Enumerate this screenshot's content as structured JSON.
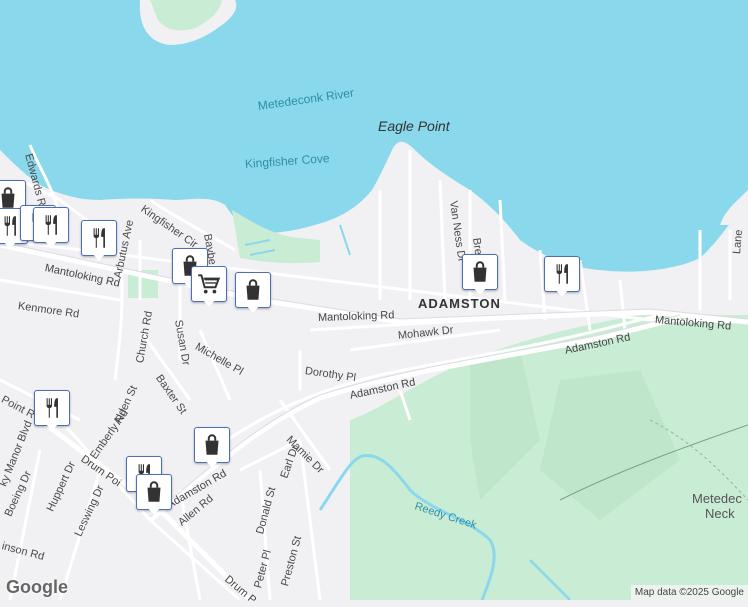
{
  "colors": {
    "water": "#8ad8ec",
    "land": "#f1f1f4",
    "park": "#c9ecd4",
    "road": "#ffffff",
    "pin_border": "#4d6fb5"
  },
  "labels": {
    "metedeconk_river": "Metedeconk River",
    "eagle_point": "Eagle Point",
    "kingfisher_cove": "Kingfisher Cove",
    "adamston": "ADAMSTON",
    "metedeconk_neck": "Metedec",
    "metedeconk_neck2": "Neck",
    "reedy_creek": "Reedy Creek"
  },
  "roads": {
    "mantoloking_rd_w": "Mantoloking Rd",
    "mantoloking_rd_c": "Mantoloking Rd",
    "mantoloking_rd_e": "Mantoloking Rd",
    "adamston_rd_c": "Adamston Rd",
    "adamston_rd_e": "Adamston Rd",
    "adamston_rd_sw": "Adamston Rd",
    "kenmore_rd": "Kenmore Rd",
    "mohawk_dr": "Mohawk Dr",
    "dorothy_pl": "Dorothy Pl",
    "edwards_rd": "Edwards Rd",
    "kingfisher_cir": "Kingfisher Cir",
    "arbutus_ave": "Arbutus Ave",
    "baybe": "Baybe",
    "church_rd": "Church Rd",
    "susan_dr": "Susan Dr",
    "michelle_pl": "Michelle Pl",
    "baxter_st": "Baxter St",
    "alden_st": "Alden St",
    "emberly_rd": "Emberly Rd",
    "point_rd": "Point R",
    "sky_manor_blvd": "ky Manor Blvd",
    "drum_point_rd_w": "Drum Poi",
    "drum_point_rd_s": "Drum P",
    "huppert_dr": "Huppert Dr",
    "boeing_dr": "Boeing Dr",
    "leswing_dr": "Leswing Dr",
    "inson_rd": "inson Rd",
    "allen_rd": "Allen Rd",
    "mamie_dr": "Mamie Dr",
    "earl_dr": "Earl Dr",
    "donald_st": "Donald St",
    "peter_pl": "Peter Pl",
    "preston_st": "Preston St",
    "van_ness_dr": "Van Ness Dr",
    "bret": "Bret",
    "lane": "Lane"
  },
  "pins": [
    {
      "icon": "shopping-bag-icon"
    },
    {
      "icon": "fork-knife-icon"
    },
    {
      "icon": "fork-knife-icon"
    },
    {
      "icon": "fork-knife-icon"
    },
    {
      "icon": "shopping-bag-icon"
    },
    {
      "icon": "shopping-cart-icon"
    },
    {
      "icon": "shopping-bag-icon"
    },
    {
      "icon": "shopping-bag-icon"
    },
    {
      "icon": "fork-knife-icon"
    },
    {
      "icon": "fork-knife-icon"
    },
    {
      "icon": "shopping-bag-icon"
    },
    {
      "icon": "fork-knife-icon"
    },
    {
      "icon": "shopping-bag-icon"
    }
  ],
  "google_logo": "Google",
  "attribution": "Map data ©2025 Google"
}
